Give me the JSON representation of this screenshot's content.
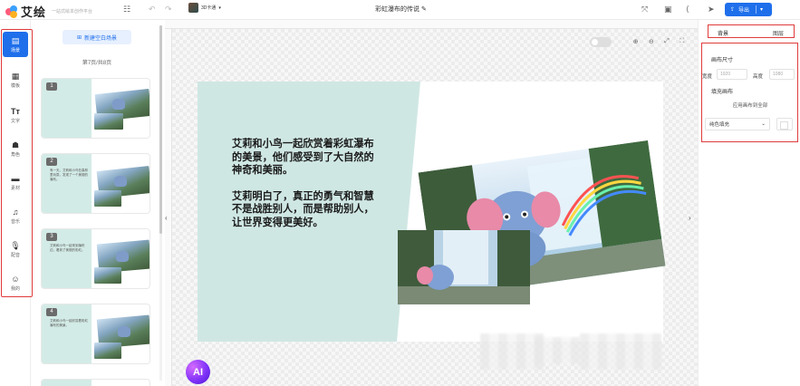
{
  "app": {
    "name": "艾绘",
    "tagline": "一站式绘本创作平台",
    "document_title": "彩虹瀑布的传说",
    "style_selector": "3D卡通",
    "export_label": "导出",
    "accent_color": "#1f6feb"
  },
  "toolbar_icons": [
    "logo-icon",
    "menu-grid-icon",
    "undo-icon",
    "redo-icon",
    "edit-icon",
    "ratio-icon",
    "save-icon",
    "share-icon",
    "send-icon",
    "download-icon",
    "chevron-down-icon"
  ],
  "nav": {
    "items": [
      {
        "label": "场景",
        "icon": "scene-icon",
        "active": true
      },
      {
        "label": "模板",
        "icon": "template-icon",
        "active": false
      },
      {
        "label": "文字",
        "icon": "text-icon",
        "active": false
      },
      {
        "label": "角色",
        "icon": "character-icon",
        "active": false
      },
      {
        "label": "素材",
        "icon": "material-icon",
        "active": false
      },
      {
        "label": "音乐",
        "icon": "music-icon",
        "active": false
      },
      {
        "label": "配音",
        "icon": "mic-icon",
        "active": false
      },
      {
        "label": "我的",
        "icon": "user-icon",
        "active": false
      }
    ]
  },
  "scene_panel": {
    "new_button": "新建空白场景",
    "page_count": "第7页/共8页",
    "scenes": [
      {
        "num": "1",
        "text": ""
      },
      {
        "num": "2",
        "text": "有一天，艾莉和小鸟在森林里玩耍，发现了一个美丽的瀑布。"
      },
      {
        "num": "3",
        "text": "艾莉和小鸟一起来到瀑布边，看到了美丽的彩虹。"
      },
      {
        "num": "4",
        "text": "艾莉和小鸟一起欣赏着彩虹瀑布的美景。"
      }
    ]
  },
  "canvas": {
    "paragraph1": "艾莉和小鸟一起欣赏着彩虹瀑布的美景，他们感受到了大自然的神奇和美丽。",
    "paragraph2": "艾莉明白了，真正的勇气和智慧不是战胜别人，而是帮助别人，让世界变得更美好。",
    "slide_bg_color": "#cfe7e3",
    "ai_badge": "AI",
    "zoom_icons": [
      "zoom-in-icon",
      "zoom-out-icon",
      "fullscreen-icon",
      "fit-icon"
    ]
  },
  "right_panel": {
    "tab_background": "背景",
    "tab_layers": "图层",
    "canvas_size_title": "画布尺寸",
    "width_label": "宽度",
    "width_value": "1920",
    "height_label": "高度",
    "height_value": "1080",
    "fill_title": "填充画布",
    "apply_all": "应用画布到全部",
    "fill_type": "纯色填充"
  }
}
